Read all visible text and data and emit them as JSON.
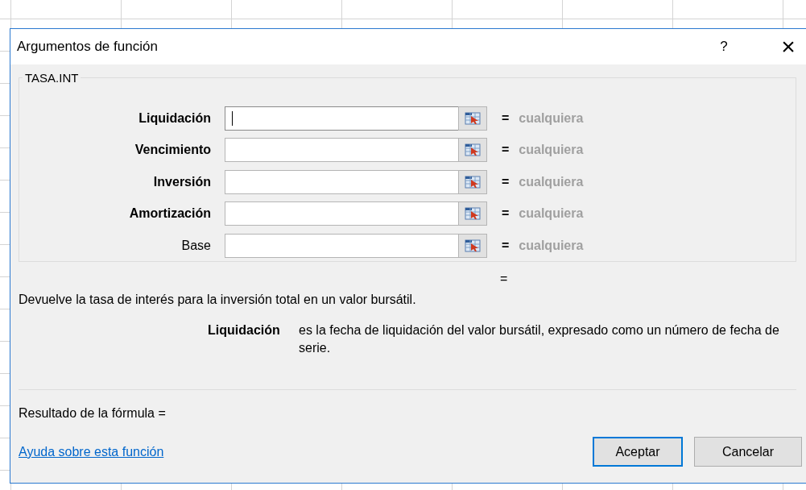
{
  "window": {
    "title": "Argumentos de función",
    "help": "?",
    "close": "×"
  },
  "function_name": "TASA.INT",
  "arguments": [
    {
      "label": "Liquidación",
      "required": true,
      "focused": true,
      "equals": "=",
      "value_hint": "cualquiera"
    },
    {
      "label": "Vencimiento",
      "required": true,
      "focused": false,
      "equals": "=",
      "value_hint": "cualquiera"
    },
    {
      "label": "Inversión",
      "required": true,
      "focused": false,
      "equals": "=",
      "value_hint": "cualquiera"
    },
    {
      "label": "Amortización",
      "required": true,
      "focused": false,
      "equals": "=",
      "value_hint": "cualquiera"
    },
    {
      "label": "Base",
      "required": false,
      "focused": false,
      "equals": "=",
      "value_hint": "cualquiera"
    }
  ],
  "result_equals": "=",
  "description": "Devuelve la tasa de interés para la inversión total en un valor bursátil.",
  "argument_help": {
    "name": "Liquidación",
    "text": "es la fecha de liquidación del valor bursátil, expresado como un número de fecha de serie."
  },
  "formula_result": "Resultado de la fórmula =",
  "help_link": "Ayuda sobre esta función",
  "buttons": [
    {
      "label": "Aceptar",
      "default": true
    },
    {
      "label": "Cancelar",
      "default": false
    }
  ]
}
